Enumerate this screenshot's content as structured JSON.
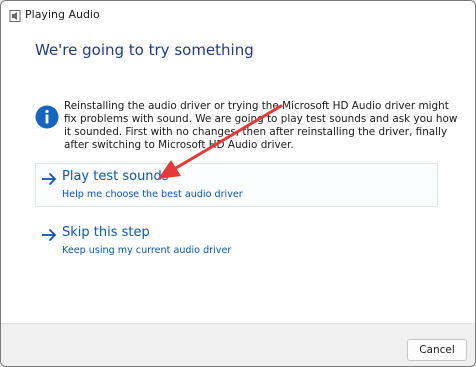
{
  "window": {
    "title": "Playing Audio",
    "app_icon": "speaker-document-icon"
  },
  "heading": "We're going to try something",
  "info": {
    "icon": "info-icon",
    "text": "Reinstalling the audio driver or trying the Microsoft HD Audio driver might fix problems with sound. We are going to play test sounds and ask you how it sounded. First with no changes, then after reinstalling the driver, finally after switching to Microsoft HD Audio driver."
  },
  "options": [
    {
      "icon": "arrow-right-icon",
      "title": "Play test sounds",
      "subtitle": "Help me choose the best audio driver"
    },
    {
      "icon": "arrow-right-icon",
      "title": "Skip this step",
      "subtitle": "Keep using my current audio driver"
    }
  ],
  "footer": {
    "cancel_label": "Cancel"
  },
  "colors": {
    "heading": "#1f3c88",
    "link": "#0b57b8",
    "info_icon": "#1565c0",
    "annotation_arrow": "#e53935"
  }
}
